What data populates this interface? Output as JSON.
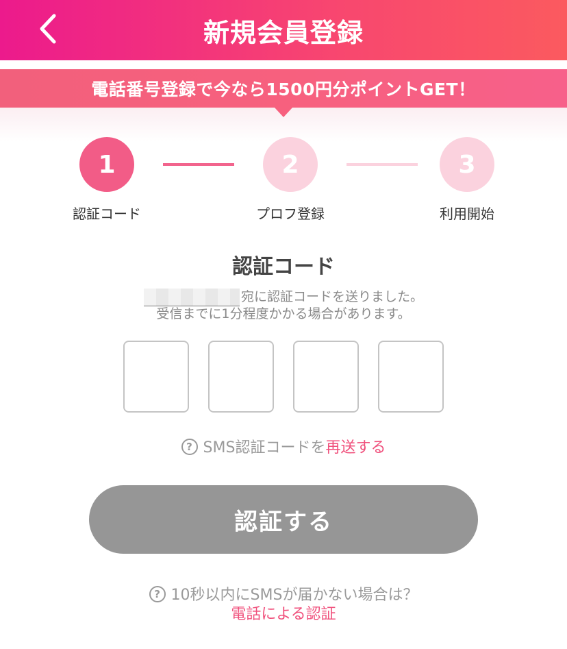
{
  "header": {
    "title": "新規会員登録",
    "back_icon": "chevron-left-icon"
  },
  "promo": {
    "text": "電話番号登録で今なら1500円分ポイントGET！"
  },
  "steps": [
    {
      "number": "1",
      "label": "認証コード",
      "state": "active"
    },
    {
      "number": "2",
      "label": "プロフ登録",
      "state": "inactive"
    },
    {
      "number": "3",
      "label": "利用開始",
      "state": "inactive"
    }
  ],
  "verification": {
    "title": "認証コード",
    "message_suffix": "宛に認証コードを送りました。",
    "message_line2": "受信までに1分程度かかる場合があります。",
    "code_values": [
      "",
      "",
      "",
      ""
    ]
  },
  "resend": {
    "prefix": "SMS認証コードを",
    "link_label": "再送する"
  },
  "submit": {
    "label": "認証する"
  },
  "no_sms": {
    "text": "10秒以内にSMSが届かない場合は？",
    "link_label": "電話による認証"
  },
  "colors": {
    "brand_pink": "#f25c87",
    "step_inactive": "#fbd2de",
    "link": "#f0507c",
    "button_disabled": "#969696"
  }
}
